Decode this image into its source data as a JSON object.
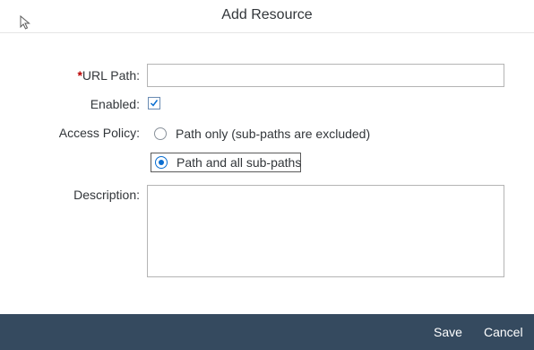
{
  "dialog": {
    "title": "Add Resource"
  },
  "form": {
    "url_path": {
      "label": "URL Path:",
      "required_marker": "*",
      "value": "",
      "placeholder": ""
    },
    "enabled": {
      "label": "Enabled:",
      "checked": true
    },
    "access_policy": {
      "label": "Access Policy:",
      "options": [
        {
          "label": "Path only (sub-paths are excluded)",
          "selected": false
        },
        {
          "label": "Path and all sub-paths",
          "selected": true
        }
      ]
    },
    "description": {
      "label": "Description:",
      "value": ""
    }
  },
  "footer": {
    "save_label": "Save",
    "cancel_label": "Cancel"
  },
  "colors": {
    "required": "#bb0000",
    "accent": "#0a6ed1",
    "footer_bg": "#354a5f"
  }
}
